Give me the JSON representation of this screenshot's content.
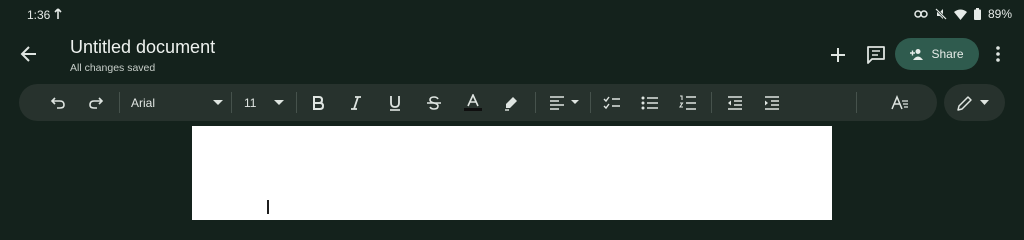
{
  "status_bar": {
    "time": "1:36",
    "battery": "89%",
    "icons": [
      "upload-arrow-icon",
      "link-icon",
      "mute-icon",
      "wifi-icon",
      "battery-icon"
    ]
  },
  "header": {
    "title": "Untitled document",
    "subtitle": "All changes saved",
    "share_label": "Share",
    "icons": [
      "back-arrow-icon",
      "add-icon",
      "comment-icon",
      "person-add-icon",
      "more-vert-icon"
    ]
  },
  "toolbar": {
    "font": "Arial",
    "font_size": "11",
    "icons": [
      "undo-icon",
      "redo-icon",
      "bold-icon",
      "italic-icon",
      "underline-icon",
      "strikethrough-icon",
      "text-color-icon",
      "highlight-icon",
      "align-icon",
      "checklist-icon",
      "bullet-list-icon",
      "numbered-list-icon",
      "decrease-indent-icon",
      "increase-indent-icon",
      "text-format-icon",
      "edit-mode-icon"
    ]
  },
  "colors": {
    "background": "#14221c",
    "toolbar": "#27322d",
    "share_button": "#2f5b4e",
    "page": "#ffffff"
  }
}
